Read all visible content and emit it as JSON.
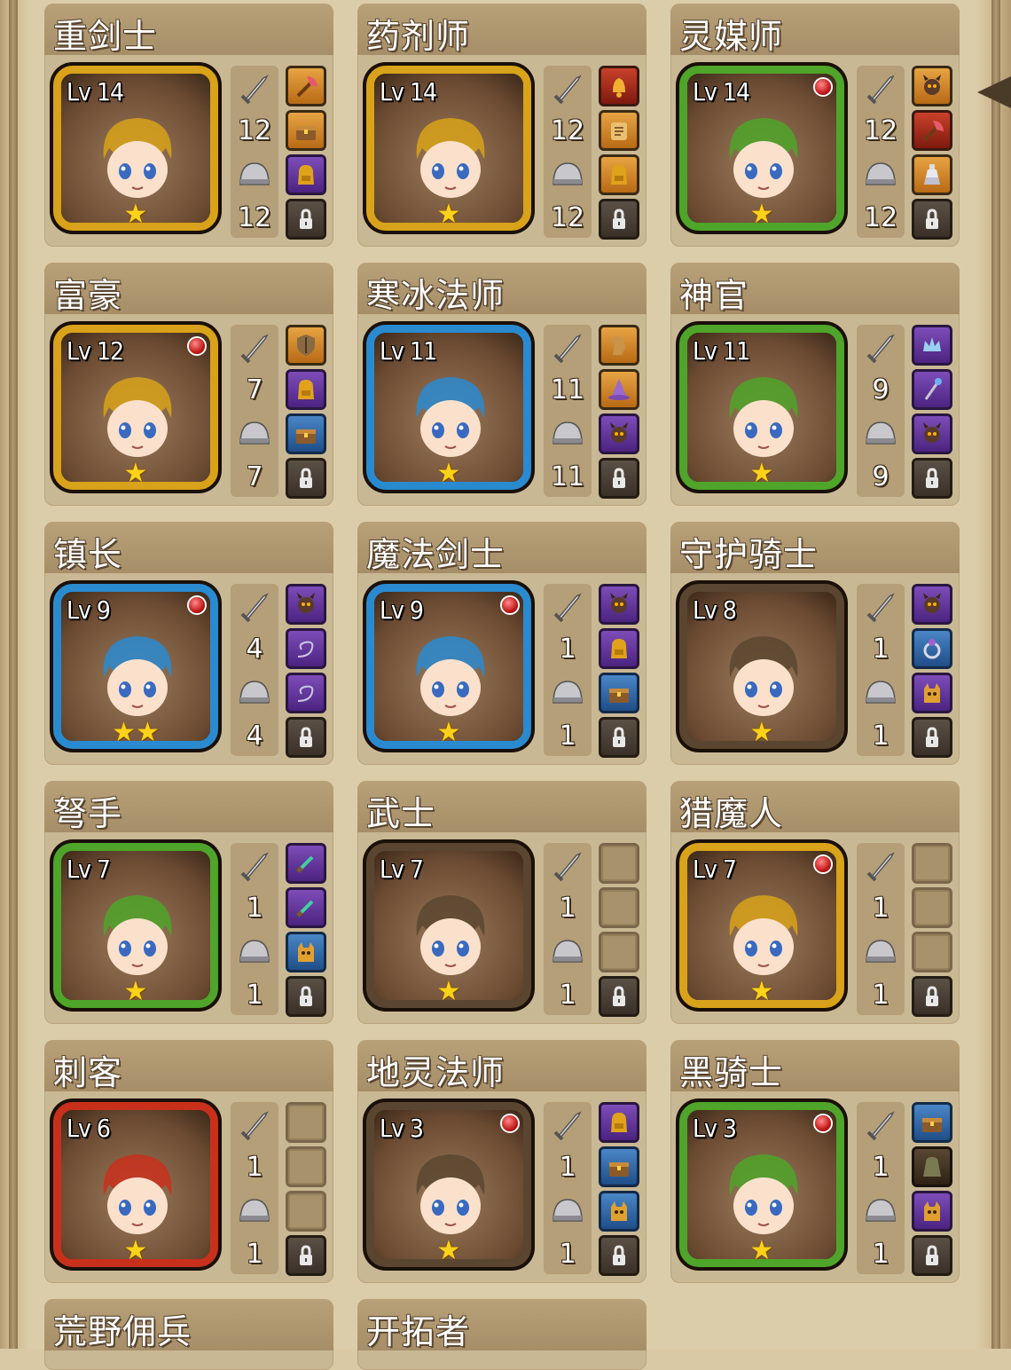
{
  "roster": [
    {
      "name": "重剑士",
      "level": "Lv 14",
      "frame": "#d8a21a",
      "stars": "★",
      "attack": "12",
      "defense": "12",
      "red_dot": false,
      "slots": [
        {
          "color": "c-orange",
          "icon": "axe-icon"
        },
        {
          "color": "c-orange",
          "icon": "chest-icon"
        },
        {
          "color": "c-purple",
          "icon": "backpack-icon"
        },
        {
          "color": "lock",
          "icon": "lock-icon"
        }
      ]
    },
    {
      "name": "药剂师",
      "level": "Lv 14",
      "frame": "#d8a21a",
      "stars": "★",
      "attack": "12",
      "defense": "12",
      "red_dot": false,
      "slots": [
        {
          "color": "c-red",
          "icon": "bell-icon"
        },
        {
          "color": "c-orange",
          "icon": "scroll-icon"
        },
        {
          "color": "c-orange",
          "icon": "backpack-icon"
        },
        {
          "color": "lock",
          "icon": "lock-icon"
        }
      ]
    },
    {
      "name": "灵媒师",
      "level": "Lv 14",
      "frame": "#4fa42a",
      "stars": "★",
      "attack": "12",
      "defense": "12",
      "red_dot": true,
      "slots": [
        {
          "color": "c-orange",
          "icon": "demon-icon"
        },
        {
          "color": "c-red",
          "icon": "axe-icon"
        },
        {
          "color": "c-orange",
          "icon": "potion-icon"
        },
        {
          "color": "lock",
          "icon": "lock-icon"
        }
      ]
    },
    {
      "name": "富豪",
      "level": "Lv 12",
      "frame": "#d8a21a",
      "stars": "★",
      "attack": "7",
      "defense": "7",
      "red_dot": true,
      "slots": [
        {
          "color": "c-orange",
          "icon": "shield-icon"
        },
        {
          "color": "c-purple",
          "icon": "backpack-icon"
        },
        {
          "color": "c-blue",
          "icon": "chest-icon"
        },
        {
          "color": "lock",
          "icon": "lock-icon"
        }
      ]
    },
    {
      "name": "寒冰法师",
      "level": "Lv 11",
      "frame": "#2a8ad0",
      "stars": "★",
      "attack": "11",
      "defense": "11",
      "red_dot": false,
      "slots": [
        {
          "color": "c-orange",
          "icon": "horse-icon"
        },
        {
          "color": "c-orange",
          "icon": "wizard-hat-icon"
        },
        {
          "color": "c-purple",
          "icon": "demon-icon"
        },
        {
          "color": "lock",
          "icon": "lock-icon"
        }
      ]
    },
    {
      "name": "神官",
      "level": "Lv 11",
      "frame": "#4fa42a",
      "stars": "★",
      "attack": "9",
      "defense": "9",
      "red_dot": false,
      "slots": [
        {
          "color": "c-purple",
          "icon": "crown-icon"
        },
        {
          "color": "c-purple",
          "icon": "staff-icon"
        },
        {
          "color": "c-purple",
          "icon": "demon-icon"
        },
        {
          "color": "lock",
          "icon": "lock-icon"
        }
      ]
    },
    {
      "name": "镇长",
      "level": "Lv 9",
      "frame": "#2a8ad0",
      "stars": "★★",
      "attack": "4",
      "defense": "4",
      "red_dot": true,
      "slots": [
        {
          "color": "c-purple",
          "icon": "demon-icon"
        },
        {
          "color": "c-purple",
          "icon": "whip-icon"
        },
        {
          "color": "c-purple",
          "icon": "whip-icon"
        },
        {
          "color": "lock",
          "icon": "lock-icon"
        }
      ]
    },
    {
      "name": "魔法剑士",
      "level": "Lv 9",
      "frame": "#2a8ad0",
      "stars": "★",
      "attack": "1",
      "defense": "1",
      "red_dot": true,
      "slots": [
        {
          "color": "c-purple",
          "icon": "demon-icon"
        },
        {
          "color": "c-purple",
          "icon": "backpack-icon"
        },
        {
          "color": "c-blue",
          "icon": "chest-icon"
        },
        {
          "color": "lock",
          "icon": "lock-icon"
        }
      ]
    },
    {
      "name": "守护骑士",
      "level": "Lv 8",
      "frame": "#5a4630",
      "stars": "★",
      "attack": "1",
      "defense": "1",
      "red_dot": false,
      "slots": [
        {
          "color": "c-purple",
          "icon": "demon-icon"
        },
        {
          "color": "c-blue",
          "icon": "ring-icon"
        },
        {
          "color": "c-purple",
          "icon": "cat-icon"
        },
        {
          "color": "lock",
          "icon": "lock-icon"
        }
      ]
    },
    {
      "name": "弩手",
      "level": "Lv 7",
      "frame": "#4fa42a",
      "stars": "★",
      "attack": "1",
      "defense": "1",
      "red_dot": false,
      "slots": [
        {
          "color": "c-purple",
          "icon": "dagger-icon"
        },
        {
          "color": "c-purple",
          "icon": "dagger-icon"
        },
        {
          "color": "c-blue",
          "icon": "cat-icon"
        },
        {
          "color": "lock",
          "icon": "lock-icon"
        }
      ]
    },
    {
      "name": "武士",
      "level": "Lv 7",
      "frame": "#5a4630",
      "stars": "★",
      "attack": "1",
      "defense": "1",
      "red_dot": false,
      "slots": [
        {
          "color": "empty",
          "icon": ""
        },
        {
          "color": "empty",
          "icon": ""
        },
        {
          "color": "empty",
          "icon": ""
        },
        {
          "color": "lock",
          "icon": "lock-icon"
        }
      ]
    },
    {
      "name": "猎魔人",
      "level": "Lv 7",
      "frame": "#d8a21a",
      "stars": "★",
      "attack": "1",
      "defense": "1",
      "red_dot": true,
      "slots": [
        {
          "color": "empty",
          "icon": ""
        },
        {
          "color": "empty",
          "icon": ""
        },
        {
          "color": "empty",
          "icon": ""
        },
        {
          "color": "lock",
          "icon": "lock-icon"
        }
      ]
    },
    {
      "name": "刺客",
      "level": "Lv 6",
      "frame": "#c8301c",
      "stars": "★",
      "attack": "1",
      "defense": "1",
      "red_dot": false,
      "slots": [
        {
          "color": "empty",
          "icon": ""
        },
        {
          "color": "empty",
          "icon": ""
        },
        {
          "color": "empty",
          "icon": ""
        },
        {
          "color": "lock",
          "icon": "lock-icon"
        }
      ]
    },
    {
      "name": "地灵法师",
      "level": "Lv 3",
      "frame": "#5a4630",
      "stars": "★",
      "attack": "1",
      "defense": "1",
      "red_dot": true,
      "slots": [
        {
          "color": "c-purple",
          "icon": "backpack-icon"
        },
        {
          "color": "c-blue",
          "icon": "chest-icon"
        },
        {
          "color": "c-blue",
          "icon": "cat-icon"
        },
        {
          "color": "lock",
          "icon": "lock-icon"
        }
      ]
    },
    {
      "name": "黑骑士",
      "level": "Lv 3",
      "frame": "#4fa42a",
      "stars": "★",
      "attack": "1",
      "defense": "1",
      "red_dot": true,
      "slots": [
        {
          "color": "c-blue",
          "icon": "chest-icon"
        },
        {
          "color": "c-dark",
          "icon": "bag-icon"
        },
        {
          "color": "c-purple",
          "icon": "cat-icon"
        },
        {
          "color": "lock",
          "icon": "lock-icon"
        }
      ]
    },
    {
      "name": "荒野佣兵",
      "partial": true
    },
    {
      "name": "开拓者",
      "partial": true
    }
  ]
}
